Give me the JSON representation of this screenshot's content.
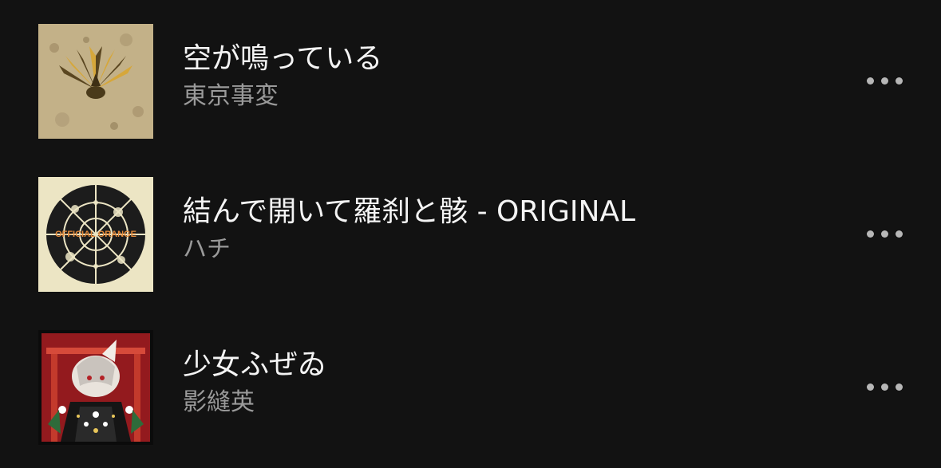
{
  "tracks": [
    {
      "title": "空が鳴っている",
      "artist": "東京事変",
      "artwork_icon": "sand-peacock-album-art"
    },
    {
      "title": "結んで開いて羅刹と骸 - ORIGINAL",
      "artist": "ハチ",
      "artwork_icon": "official-orange-album-art",
      "artwork_text": "OFFICIAL ORANGE"
    },
    {
      "title": "少女ふぜゐ",
      "artist": "影縫英",
      "artwork_icon": "shrine-girl-album-art"
    }
  ],
  "more_icon": "more-horizontal-icon",
  "colors": {
    "background": "#121212",
    "title": "#f4f4f4",
    "subtitle": "#9a9a9a",
    "more_dots": "#b7b7b7",
    "artwork_orange": "#e58a3a"
  }
}
